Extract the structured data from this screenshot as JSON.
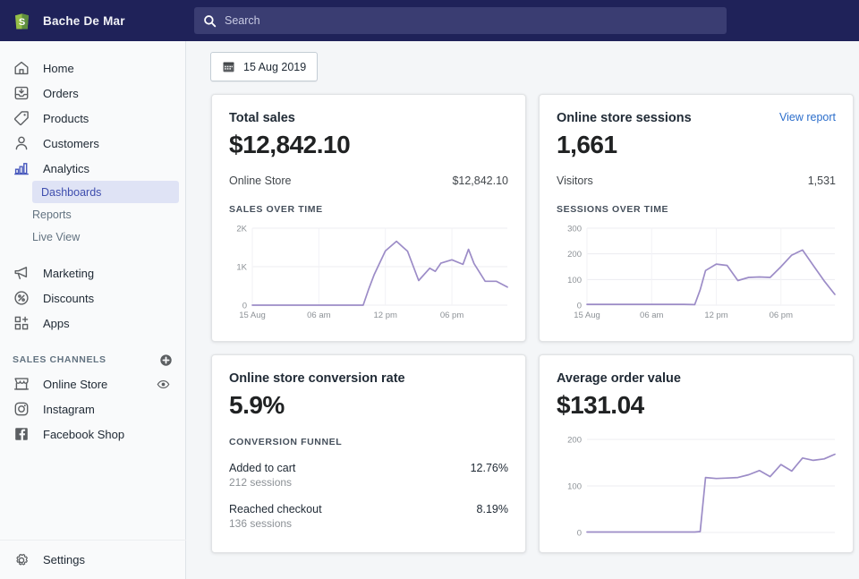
{
  "topbar": {
    "brand_name": "Bache De Mar",
    "logo_icon": "shopify-bag-icon",
    "search_icon": "search-icon",
    "search_placeholder": "Search",
    "search_value": "",
    "bg_color": "#1f2259"
  },
  "sidebar": {
    "items": [
      {
        "label": "Home",
        "icon": "home-icon"
      },
      {
        "label": "Orders",
        "icon": "orders-inbox-icon"
      },
      {
        "label": "Products",
        "icon": "tag-icon"
      },
      {
        "label": "Customers",
        "icon": "person-icon"
      },
      {
        "label": "Analytics",
        "icon": "bar-chart-icon"
      }
    ],
    "analytics_children": [
      {
        "label": "Dashboards",
        "active": true
      },
      {
        "label": "Reports",
        "active": false
      },
      {
        "label": "Live View",
        "active": false
      }
    ],
    "items2": [
      {
        "label": "Marketing",
        "icon": "megaphone-icon"
      },
      {
        "label": "Discounts",
        "icon": "discount-percent-icon"
      },
      {
        "label": "Apps",
        "icon": "apps-grid-icon"
      }
    ],
    "sales_channels_header": "SALES CHANNELS",
    "add_channel_icon": "plus-circle-icon",
    "channels": [
      {
        "label": "Online Store",
        "icon": "storefront-icon",
        "trailing_icon": "eye-icon"
      },
      {
        "label": "Instagram",
        "icon": "instagram-icon",
        "trailing_icon": ""
      },
      {
        "label": "Facebook Shop",
        "icon": "facebook-icon",
        "trailing_icon": ""
      }
    ],
    "settings": {
      "label": "Settings",
      "icon": "gear-icon"
    },
    "active_bg_color": "#dfe3f5",
    "active_text_color": "#3f4eae"
  },
  "main": {
    "date_picker": {
      "label": "15 Aug 2019",
      "icon": "calendar-icon"
    },
    "cards": {
      "total_sales": {
        "title": "Total sales",
        "value": "$12,842.10",
        "breakdown_label": "Online Store",
        "breakdown_value": "$12,842.10",
        "chart_caption": "SALES OVER TIME"
      },
      "sessions": {
        "title": "Online store sessions",
        "link": "View report",
        "value": "1,661",
        "breakdown_label": "Visitors",
        "breakdown_value": "1,531",
        "chart_caption": "SESSIONS OVER TIME"
      },
      "conversion": {
        "title": "Online store conversion rate",
        "value": "5.9%",
        "funnel_caption": "CONVERSION FUNNEL",
        "steps": [
          {
            "label": "Added to cart",
            "pct": "12.76%",
            "sessions": "212 sessions"
          },
          {
            "label": "Reached checkout",
            "pct": "8.19%",
            "sessions": "136 sessions"
          }
        ]
      },
      "aov": {
        "title": "Average order value",
        "value": "$131.04"
      }
    }
  },
  "chart_data": [
    {
      "id": "sales_over_time",
      "type": "line",
      "title": "SALES OVER TIME",
      "xlabel": "",
      "ylabel": "",
      "ylim": [
        0,
        2000
      ],
      "yticks": [
        0,
        1000,
        2000
      ],
      "ytick_labels": [
        "0",
        "1K",
        "2K"
      ],
      "xticks": [
        0,
        6,
        12,
        18
      ],
      "xtick_labels": [
        "15 Aug",
        "06 am",
        "12 pm",
        "06 pm"
      ],
      "grid": true,
      "line_color": "#9c8cc7",
      "x": [
        0,
        1,
        2,
        3,
        4,
        5,
        6,
        7,
        8,
        9,
        10,
        10.5,
        11,
        12,
        13,
        13.5,
        14,
        15,
        16,
        16.5,
        17,
        18,
        19,
        19.5,
        20,
        21,
        22,
        23
      ],
      "values": [
        0,
        0,
        0,
        0,
        0,
        0,
        0,
        0,
        0,
        0,
        0,
        420,
        800,
        1410,
        1660,
        1530,
        1400,
        640,
        960,
        880,
        1090,
        1180,
        1060,
        1450,
        1080,
        620,
        620,
        470
      ]
    },
    {
      "id": "sessions_over_time",
      "type": "line",
      "title": "SESSIONS OVER TIME",
      "xlabel": "",
      "ylabel": "",
      "ylim": [
        0,
        300
      ],
      "yticks": [
        0,
        100,
        200,
        300
      ],
      "ytick_labels": [
        "0",
        "100",
        "200",
        "300"
      ],
      "xticks": [
        0,
        6,
        12,
        18
      ],
      "xtick_labels": [
        "15 Aug",
        "06 am",
        "12 pm",
        "06 pm"
      ],
      "grid": true,
      "line_color": "#9c8cc7",
      "x": [
        0,
        1,
        2,
        3,
        4,
        5,
        6,
        7,
        8,
        9,
        10,
        10.5,
        11,
        12,
        13,
        14,
        15,
        16,
        17,
        18,
        19,
        20,
        21,
        22,
        23
      ],
      "values": [
        3,
        3,
        3,
        3,
        3,
        3,
        3,
        3,
        3,
        3,
        2,
        60,
        135,
        160,
        155,
        96,
        108,
        110,
        108,
        150,
        195,
        215,
        155,
        95,
        42
      ]
    },
    {
      "id": "average_order_value",
      "type": "line",
      "title": "Average order value",
      "xlabel": "",
      "ylabel": "",
      "ylim": [
        0,
        200
      ],
      "yticks": [
        0,
        100,
        200
      ],
      "ytick_labels": [
        "0",
        "100",
        "200"
      ],
      "grid": true,
      "line_color": "#9c8cc7",
      "x": [
        0,
        1,
        2,
        3,
        4,
        5,
        6,
        7,
        8,
        9,
        10,
        10.5,
        11,
        12,
        13,
        14,
        15,
        16,
        17,
        18,
        19,
        20,
        21,
        22,
        23
      ],
      "values": [
        1,
        1,
        1,
        1,
        1,
        1,
        1,
        1,
        1,
        1,
        1,
        2,
        118,
        116,
        117,
        118,
        124,
        133,
        120,
        146,
        132,
        160,
        155,
        158,
        168
      ]
    }
  ]
}
